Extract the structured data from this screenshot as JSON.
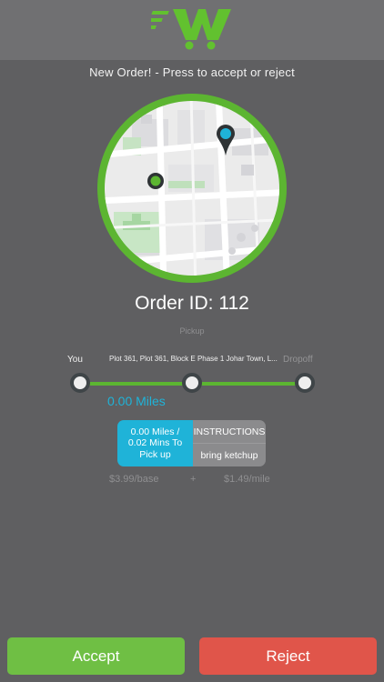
{
  "prompt": "New Order! - Press to accept or reject",
  "order": {
    "id_text": "Order ID: 112"
  },
  "route": {
    "pickup_label": "Pickup",
    "you_label": "You",
    "address": "Plot 361, Plot 361, Block E Phase 1 Johar Town, L...",
    "dropoff_label": "Dropoff",
    "distance": "0.00 Miles"
  },
  "card": {
    "line1": "0.00 Miles /",
    "line2": "0.02 Mins To",
    "line3": "Pick up",
    "instructions_label": "INSTRUCTIONS",
    "instructions_text": "bring ketchup"
  },
  "pricing": {
    "base": "$3.99/base",
    "plus": "+",
    "per_mile": "$1.49/mile"
  },
  "buttons": {
    "accept": "Accept",
    "reject": "Reject"
  },
  "colors": {
    "brand_green": "#5cb531",
    "accent_blue": "#1fb3d8",
    "reject_red": "#e0554a",
    "background": "#5f5f61"
  },
  "icons": {
    "logo": "cart-w-logo-icon",
    "customer_pin": "map-pin-icon",
    "driver_marker": "location-dot-icon"
  }
}
